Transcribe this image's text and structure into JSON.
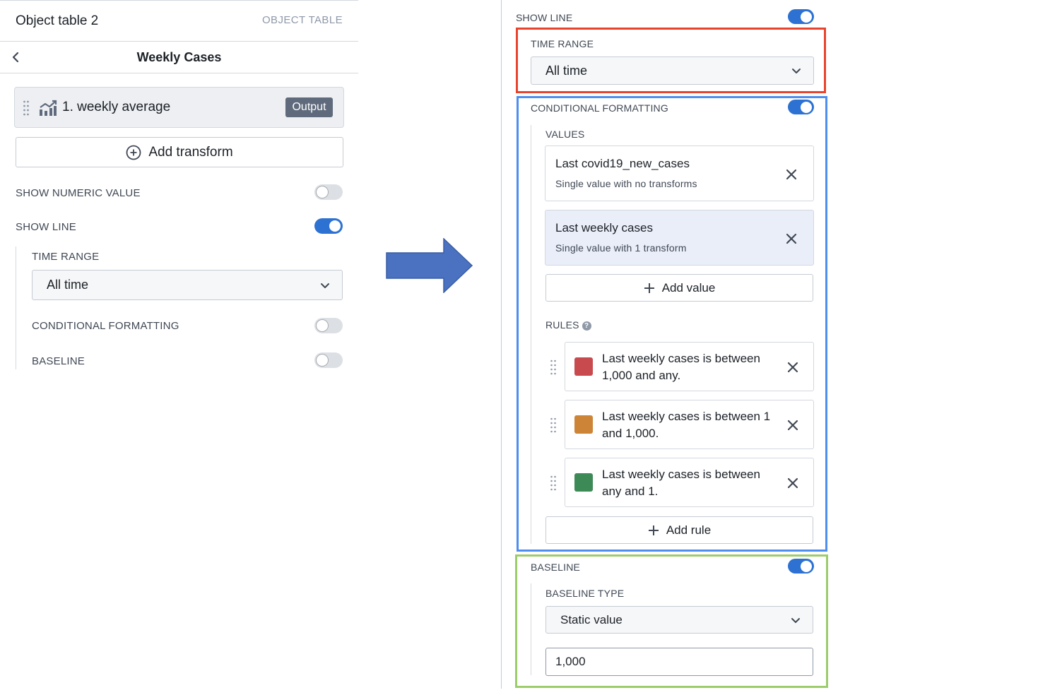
{
  "left": {
    "object_title": "Object table 2",
    "object_type": "OBJECT TABLE",
    "panel_title": "Weekly Cases",
    "transform": {
      "label": "1. weekly average",
      "badge": "Output",
      "icon": "line-chart-icon"
    },
    "add_transform_label": "Add transform",
    "show_numeric_value": {
      "label": "SHOW NUMERIC VALUE",
      "on": false
    },
    "show_line": {
      "label": "SHOW LINE",
      "on": true
    },
    "time_range": {
      "label": "TIME RANGE",
      "value": "All time"
    },
    "conditional_formatting": {
      "label": "CONDITIONAL FORMATTING",
      "on": false
    },
    "baseline": {
      "label": "BASELINE",
      "on": false
    }
  },
  "right": {
    "show_line": {
      "label": "SHOW LINE",
      "on": true
    },
    "time_range": {
      "label": "TIME RANGE",
      "value": "All time"
    },
    "conditional_formatting": {
      "label": "CONDITIONAL FORMATTING",
      "on": true,
      "values_label": "VALUES",
      "values": [
        {
          "title": "Last covid19_new_cases",
          "subtitle": "Single value with no transforms",
          "selected": false
        },
        {
          "title": "Last weekly cases",
          "subtitle": "Single value with 1 transform",
          "selected": true
        }
      ],
      "add_value_label": "Add value",
      "rules_label": "RULES",
      "rules": [
        {
          "text": "Last weekly cases is between 1,000 and any.",
          "color": "#c84a4e"
        },
        {
          "text": "Last weekly cases is between 1 and 1,000.",
          "color": "#cd8436"
        },
        {
          "text": "Last weekly cases is between any and 1.",
          "color": "#3d8a57"
        }
      ],
      "add_rule_label": "Add rule"
    },
    "baseline": {
      "label": "BASELINE",
      "on": true,
      "type_label": "BASELINE TYPE",
      "type_value": "Static value",
      "value": "1,000"
    }
  },
  "colors": {
    "toggle_on": "#2d72d2",
    "highlight_red": "#e8432c",
    "highlight_blue": "#4d8ef0",
    "highlight_green": "#9dcc6b",
    "arrow": "#4a72c0"
  }
}
